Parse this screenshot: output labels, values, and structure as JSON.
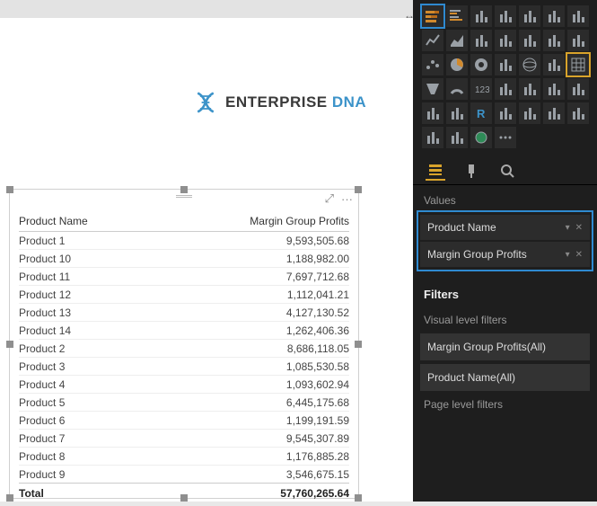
{
  "logo": {
    "brand": "ENTERPRISE",
    "accent": "DNA"
  },
  "visual_header": {
    "focus": "⤢",
    "more": "···"
  },
  "table": {
    "columns": [
      "Product Name",
      "Margin Group Profits"
    ],
    "rows": [
      {
        "name": "Product 1",
        "value": "9,593,505.68"
      },
      {
        "name": "Product 10",
        "value": "1,188,982.00"
      },
      {
        "name": "Product 11",
        "value": "7,697,712.68"
      },
      {
        "name": "Product 12",
        "value": "1,112,041.21"
      },
      {
        "name": "Product 13",
        "value": "4,127,130.52"
      },
      {
        "name": "Product 14",
        "value": "1,262,406.36"
      },
      {
        "name": "Product 2",
        "value": "8,686,118.05"
      },
      {
        "name": "Product 3",
        "value": "1,085,530.58"
      },
      {
        "name": "Product 4",
        "value": "1,093,602.94"
      },
      {
        "name": "Product 5",
        "value": "6,445,175.68"
      },
      {
        "name": "Product 6",
        "value": "1,199,191.59"
      },
      {
        "name": "Product 7",
        "value": "9,545,307.89"
      },
      {
        "name": "Product 8",
        "value": "1,176,885.28"
      },
      {
        "name": "Product 9",
        "value": "3,546,675.15"
      }
    ],
    "total_label": "Total",
    "total_value": "57,760,265.64"
  },
  "panel": {
    "vis_icons": [
      "stacked-bar",
      "clustered-bar",
      "100-bar",
      "stacked-column",
      "clustered-column",
      "100-column",
      "combo-column",
      "line",
      "area",
      "stacked-area",
      "line-col",
      "line-col-stacked",
      "ribbon",
      "waterfall",
      "scatter",
      "pie",
      "donut",
      "treemap",
      "map",
      "filled-map",
      "matrix",
      "funnel",
      "gauge",
      "card",
      "multi-card",
      "kpi",
      "slicer",
      "table",
      "r-visual",
      "py-visual",
      "r-script",
      "arcgis",
      "table-2",
      "sparkline",
      "shape",
      "custom-1",
      "custom-2",
      "globe",
      "more"
    ],
    "values_label": "Values",
    "wells": [
      {
        "label": "Product Name"
      },
      {
        "label": "Margin Group Profits"
      }
    ],
    "filters_label": "Filters",
    "visual_filters_label": "Visual level filters",
    "page_filters_label": "Page level filters",
    "filter_chips": [
      "Margin Group Profits(All)",
      "Product Name(All)"
    ]
  }
}
